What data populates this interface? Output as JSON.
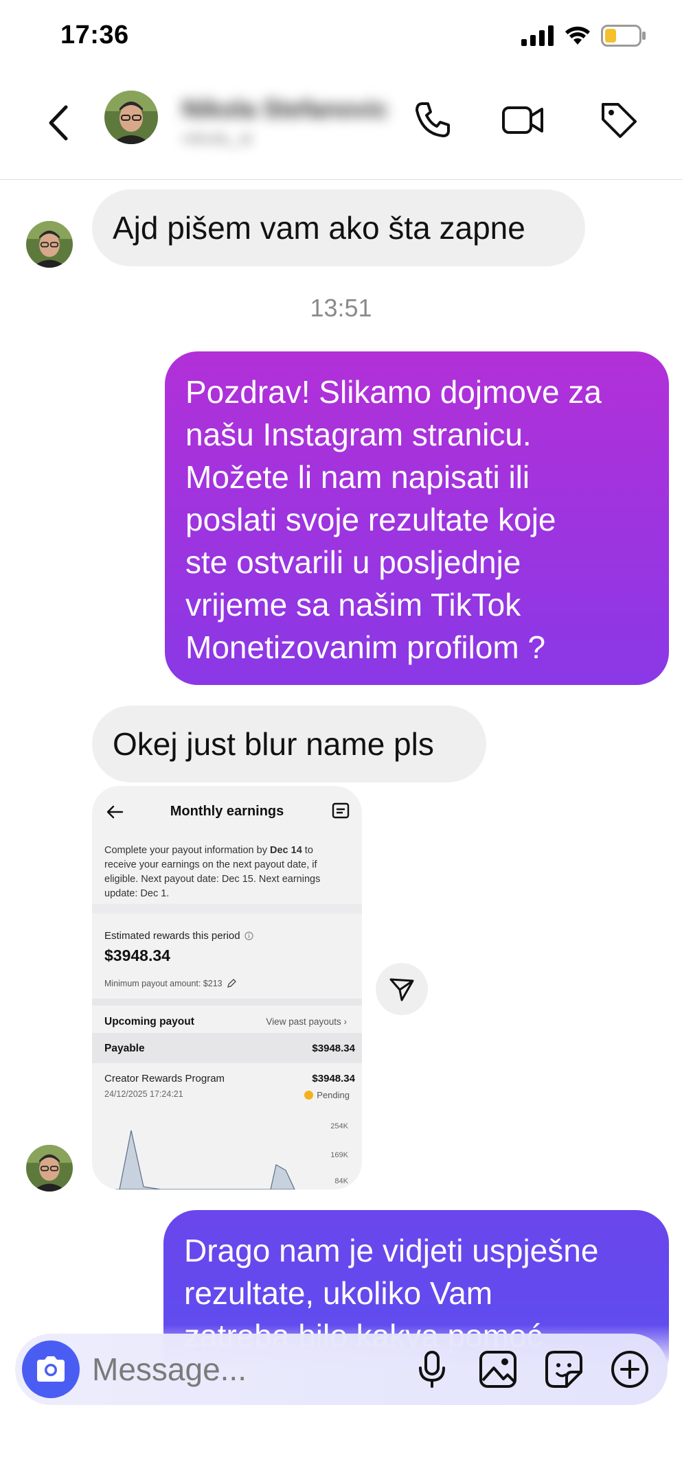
{
  "status_bar": {
    "time": "17:36"
  },
  "header": {
    "contact_name": "Nikola Stefanovic",
    "contact_subtitle": "nikola_st"
  },
  "messages": {
    "incoming_1": "Ajd pišem vam ako šta zapne",
    "timestamp": "13:51",
    "outgoing_1_lines": [
      "Pozdrav! Slikamo dojmove za",
      "našu Instagram stranicu.",
      "Možete li nam napisati ili",
      "poslati svoje rezultate koje",
      "ste ostvarili u posljednje",
      "vrijeme sa našim TikTok",
      "Monetizovanim profilom ?"
    ],
    "incoming_2": "Okej just blur name pls",
    "outgoing_2_lines": [
      "Drago nam je vidjeti uspješne",
      "rezultate, ukoliko Vam",
      "zatreba bilo kakva pomoć"
    ]
  },
  "screenshot": {
    "title": "Monthly earnings",
    "info_prefix": "Complete your payout information by",
    "info_date": "Dec 14",
    "info_suffix": "to receive your earnings on the next payout date, if eligible. Next payout date: Dec 15. Next earnings update: Dec 1.",
    "rewards_label": "Estimated rewards this period",
    "rewards_amount": "$3948.34",
    "min_payout": "Minimum payout amount: $213",
    "upcoming_label": "Upcoming payout",
    "view_past": "View past payouts",
    "payable_label": "Payable",
    "payable_amount": "$3948.34",
    "program_label": "Creator Rewards Program",
    "program_amount": "$3948.34",
    "program_date": "24/12/2025 17:24:21",
    "pending_label": "Pending",
    "y_ticks": [
      "254K",
      "169K",
      "84K"
    ]
  },
  "composer": {
    "placeholder": "Message..."
  }
}
